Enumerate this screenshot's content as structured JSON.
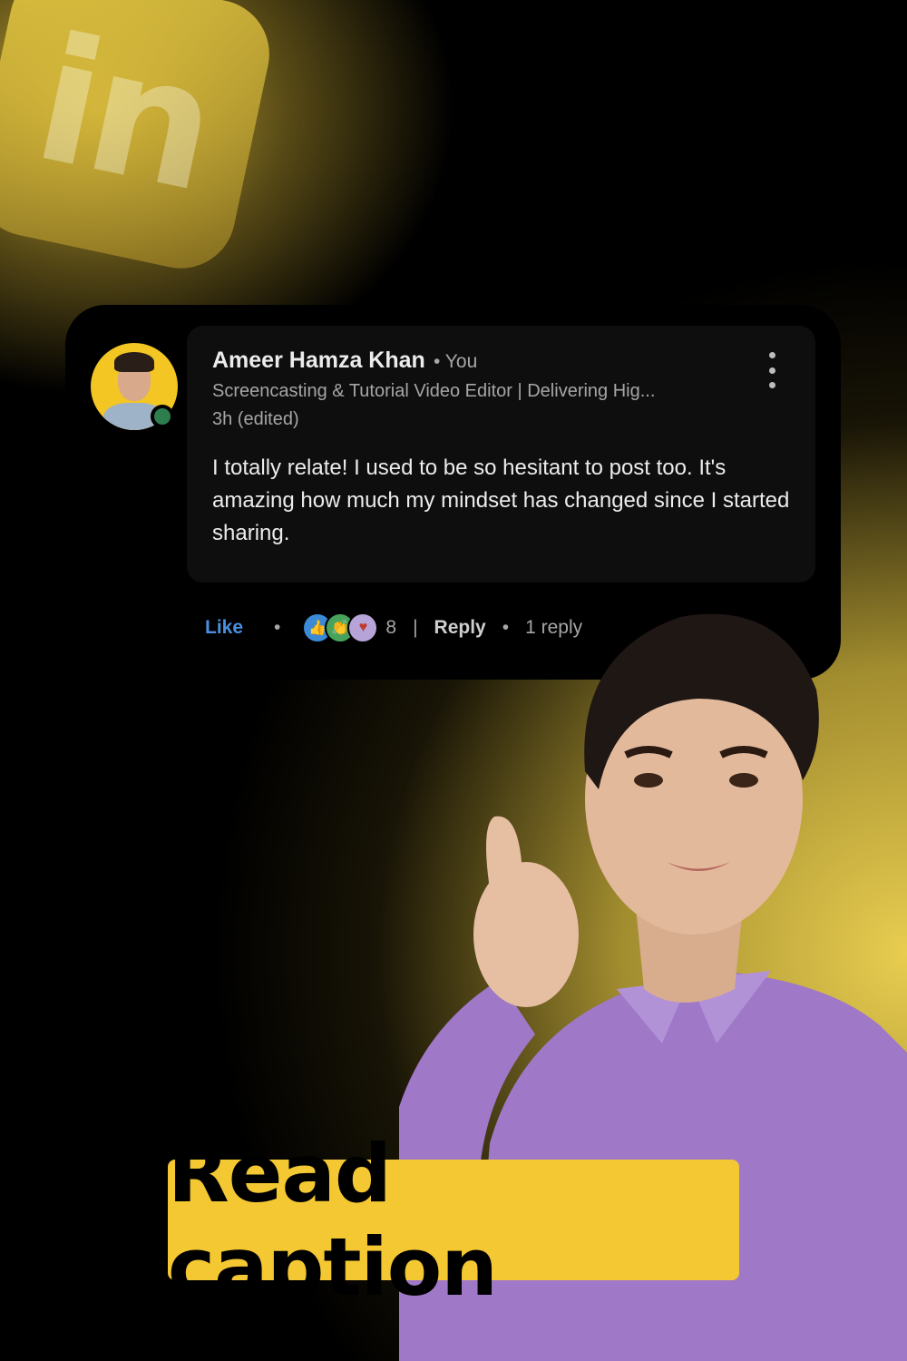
{
  "comment": {
    "author": "Ameer Hamza Khan",
    "author_tag": "• You",
    "headline": "Screencasting & Tutorial Video Editor | Delivering Hig...",
    "time": "3h (edited)",
    "text": "I totally relate! I used to be so hesitant to post too. It's amazing how much my mindset has changed since I started sharing.",
    "more_icon": "more-vertical-icon"
  },
  "actions": {
    "like_label": "Like",
    "dot": "•",
    "reaction_icons": [
      "like-reaction-icon",
      "celebrate-reaction-icon",
      "love-reaction-icon"
    ],
    "reaction_count": "8",
    "separator": "|",
    "reply_label": "Reply",
    "reply_count": "1 reply"
  },
  "caption": {
    "text": "Read caption"
  },
  "logo": {
    "text": "in"
  },
  "colors": {
    "accent_yellow": "#f4c832",
    "like_blue": "#4a8fe0",
    "shirt_purple": "#9f78c8"
  }
}
